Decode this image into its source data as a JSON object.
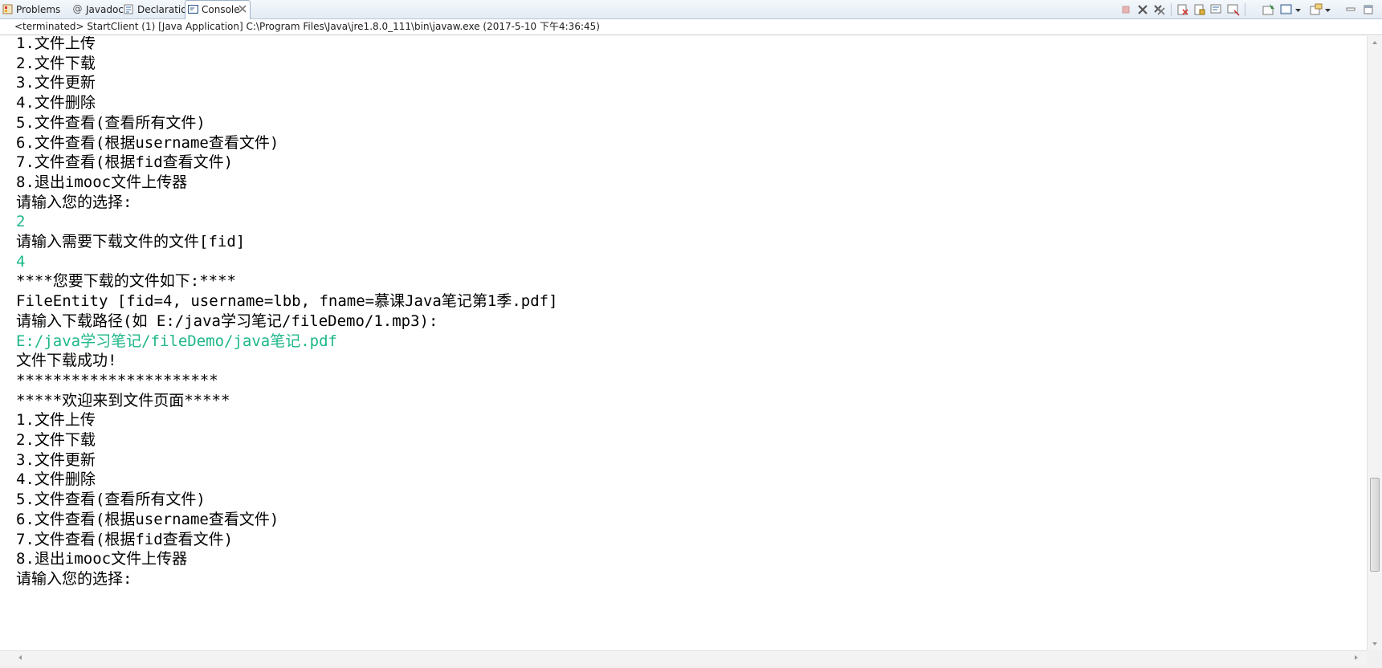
{
  "tabs": [
    {
      "label": "Problems",
      "icon": "problems-icon"
    },
    {
      "label": "Javadoc",
      "icon": "javadoc-at-icon"
    },
    {
      "label": "Declaration",
      "icon": "declaration-icon"
    },
    {
      "label": "Console",
      "icon": "console-icon",
      "active": true
    }
  ],
  "status": "<terminated> StartClient (1) [Java Application] C:\\Program Files\\Java\\jre1.8.0_111\\bin\\javaw.exe (2017-5-10 下午4:36:45)",
  "console_lines": [
    {
      "text": "1.文件上传",
      "input": false
    },
    {
      "text": "2.文件下载",
      "input": false
    },
    {
      "text": "3.文件更新",
      "input": false
    },
    {
      "text": "4.文件删除",
      "input": false
    },
    {
      "text": "5.文件查看(查看所有文件)",
      "input": false
    },
    {
      "text": "6.文件查看(根据username查看文件)",
      "input": false
    },
    {
      "text": "7.文件查看(根据fid查看文件)",
      "input": false
    },
    {
      "text": "8.退出imooc文件上传器",
      "input": false
    },
    {
      "text": "请输入您的选择:",
      "input": false
    },
    {
      "text": "2",
      "input": true
    },
    {
      "text": "请输入需要下载文件的文件[fid]",
      "input": false
    },
    {
      "text": "4",
      "input": true
    },
    {
      "text": "****您要下载的文件如下:****",
      "input": false
    },
    {
      "text": "FileEntity [fid=4, username=lbb, fname=慕课Java笔记第1季.pdf]",
      "input": false
    },
    {
      "text": "请输入下载路径(如 E:/java学习笔记/fileDemo/1.mp3):",
      "input": false
    },
    {
      "text": "E:/java学习笔记/fileDemo/java笔记.pdf",
      "input": true
    },
    {
      "text": "文件下载成功!",
      "input": false
    },
    {
      "text": "**********************",
      "input": false
    },
    {
      "text": "*****欢迎来到文件页面*****",
      "input": false
    },
    {
      "text": "1.文件上传",
      "input": false
    },
    {
      "text": "2.文件下载",
      "input": false
    },
    {
      "text": "3.文件更新",
      "input": false
    },
    {
      "text": "4.文件删除",
      "input": false
    },
    {
      "text": "5.文件查看(查看所有文件)",
      "input": false
    },
    {
      "text": "6.文件查看(根据username查看文件)",
      "input": false
    },
    {
      "text": "7.文件查看(根据fid查看文件)",
      "input": false
    },
    {
      "text": "8.退出imooc文件上传器",
      "input": false
    },
    {
      "text": "请输入您的选择:",
      "input": false
    }
  ],
  "colors": {
    "input_text": "#1fb78a",
    "output_text": "#000000"
  },
  "toolbar_icons": [
    "terminate-icon",
    "remove-launch-icon",
    "remove-all-terminated-icon",
    "clear-console-icon",
    "scroll-lock-icon",
    "word-wrap-icon",
    "show-on-output-icon",
    "pin-console-icon",
    "display-console-icon",
    "display-console-menu-icon",
    "open-console-icon",
    "open-console-menu-icon",
    "minimize-icon",
    "maximize-icon"
  ]
}
